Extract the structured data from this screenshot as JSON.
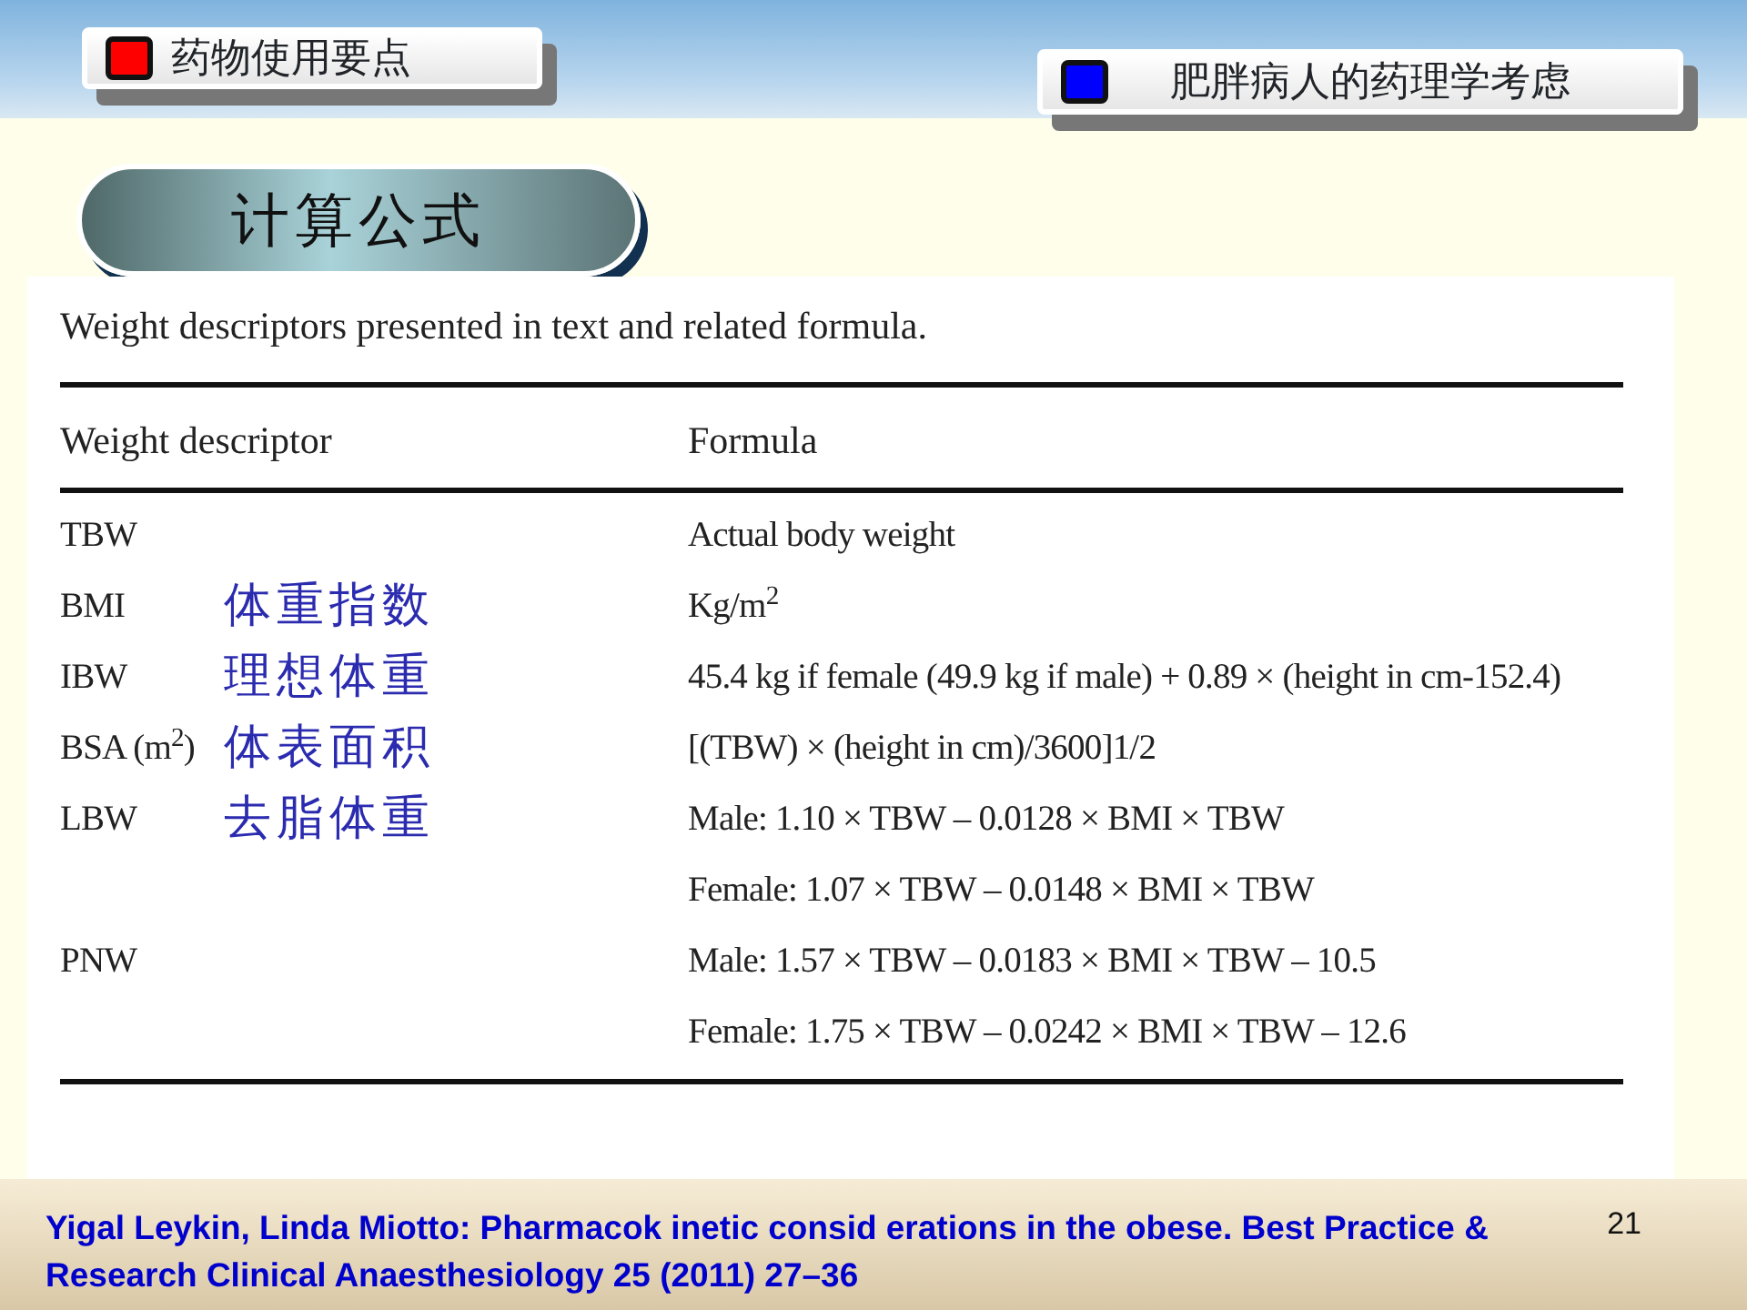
{
  "header": {
    "left_tab": {
      "label": "药物使用要点",
      "color": "#ff0000"
    },
    "right_tab": {
      "label": "肥胖病人的药理学考虑",
      "color": "#0000ff"
    }
  },
  "section_title": "计算公式",
  "table": {
    "caption": "Weight descriptors presented in text and related formula.",
    "columns": [
      "Weight descriptor",
      "Formula"
    ],
    "rows": [
      {
        "descriptor": "TBW",
        "formula": [
          "Actual body weight"
        ]
      },
      {
        "descriptor": "BMI",
        "note": "体重指数",
        "formula": [
          "Kg/m$^{2}$"
        ]
      },
      {
        "descriptor": "IBW",
        "note": "理想体重",
        "formula": [
          "45.4 kg if female (49.9 kg if male) + 0.89 × (height in cm-152.4)"
        ]
      },
      {
        "descriptor": "BSA (m$^{2}$)",
        "note": "体表面积",
        "formula": [
          "[(TBW) × (height in cm)/3600]1/2"
        ]
      },
      {
        "descriptor": "LBW",
        "note": "去脂体重",
        "formula": [
          "Male: 1.10 × TBW – 0.0128 × BMI × TBW",
          "Female: 1.07 × TBW – 0.0148 × BMI × TBW"
        ]
      },
      {
        "descriptor": "PNW",
        "formula": [
          "Male: 1.57 × TBW – 0.0183 × BMI × TBW – 10.5",
          "Female: 1.75 × TBW – 0.0242 × BMI × TBW – 12.6"
        ]
      }
    ]
  },
  "citation": "Yigal Leykin, Linda Miotto: Pharmacok inetic consid erations in the obese. Best Practice & Research Clinical Anaesthesiology 25 (2011) 27–36",
  "page_number": "21"
}
